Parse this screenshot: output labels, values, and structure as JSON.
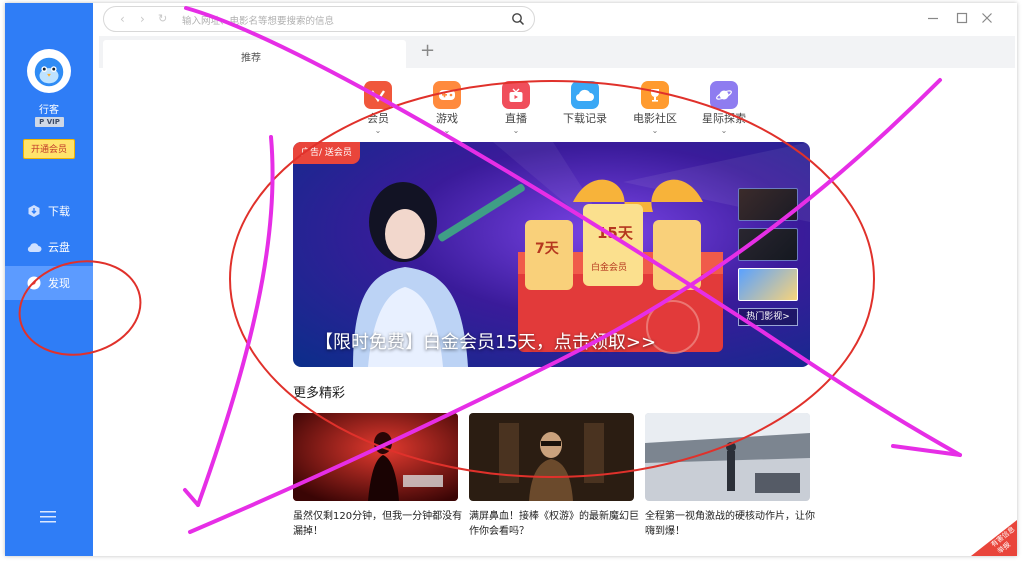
{
  "user": {
    "name": "行客",
    "vip_level": "P VIP",
    "open_vip_label": "开通会员"
  },
  "sidebar": {
    "items": [
      {
        "label": "下载"
      },
      {
        "label": "云盘"
      },
      {
        "label": "发现"
      }
    ]
  },
  "address_bar": {
    "placeholder": "输入网址、电影名等想要搜索的信息"
  },
  "tabs": [
    {
      "label": "推荐"
    }
  ],
  "categories": [
    {
      "label": "会员",
      "color": "#f0573b"
    },
    {
      "label": "游戏",
      "color": "#ff8a3d"
    },
    {
      "label": "直播",
      "color": "#f04e5b"
    },
    {
      "label": "下载记录",
      "color": "#3aa8f5"
    },
    {
      "label": "电影社区",
      "color": "#ff9b2f"
    },
    {
      "label": "星际探索",
      "color": "#8e7cf0"
    }
  ],
  "banner": {
    "ad_tag": "广告/ 送会员",
    "title": "【限时免费】白金会员15天，点击领取>>",
    "ticket_7": "7天",
    "ticket_15": "15天",
    "ticket_member": "白金会员",
    "hot_label": "热门影视>"
  },
  "more_section": {
    "title": "更多精彩"
  },
  "cards": [
    {
      "caption": "虽然仅剩120分钟，但我一分钟都没有漏掉！"
    },
    {
      "caption": "满屏鼻血！接棒《权游》的最新魔幻巨作你会看吗？"
    },
    {
      "caption": "全程第一视角激战的硬核动作片，让你嗨到爆！"
    }
  ],
  "report_badge": {
    "line1": "有害信息",
    "line2": "举报"
  },
  "colors": {
    "sidebar": "#2f7df6",
    "accent_vip": "#ffe36b",
    "annotation": "#e62ee6",
    "annotation_red": "#e0312b"
  }
}
